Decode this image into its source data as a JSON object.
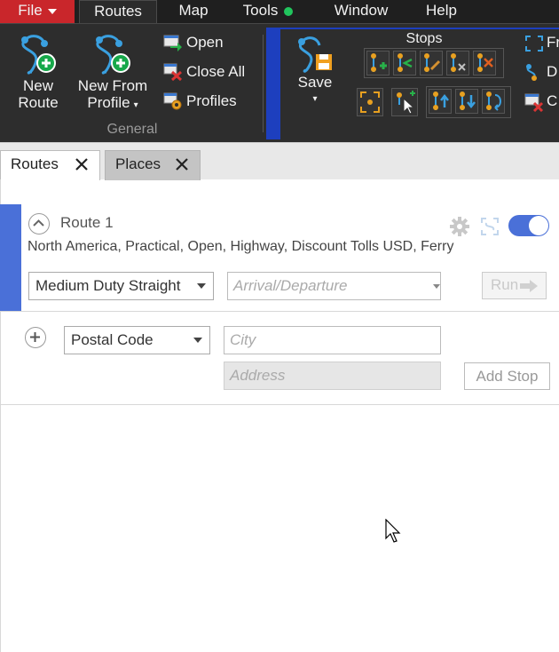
{
  "menu": {
    "file": "File",
    "routes": "Routes",
    "map": "Map",
    "tools": "Tools",
    "window": "Window",
    "help": "Help",
    "tools_status_color": "#21c55d"
  },
  "ribbon": {
    "new_route_line1": "New",
    "new_route_line2": "Route",
    "new_from_profile_line1": "New From",
    "new_from_profile_line2": "Profile",
    "open": "Open",
    "close_all": "Close All",
    "profiles": "Profiles",
    "general_group": "General",
    "save": "Save",
    "stops_group": "Stops",
    "side_label_1": "Fr",
    "side_label_2": "D",
    "side_label_3": "C",
    "accent_color": "#1d3fbe"
  },
  "tabs": {
    "routes": "Routes",
    "places": "Places"
  },
  "route": {
    "title": "Route 1",
    "description": "North America, Practical, Open, Highway, Discount Tolls USD, Ferry",
    "vehicle": "Medium Duty Straight",
    "arrival_placeholder": "Arrival/Departure",
    "run": "Run",
    "enabled": true,
    "accent_color": "#4a70d8"
  },
  "stop_entry": {
    "search_type": "Postal Code",
    "city_placeholder": "City",
    "address_placeholder": "Address",
    "add_stop": "Add Stop"
  }
}
